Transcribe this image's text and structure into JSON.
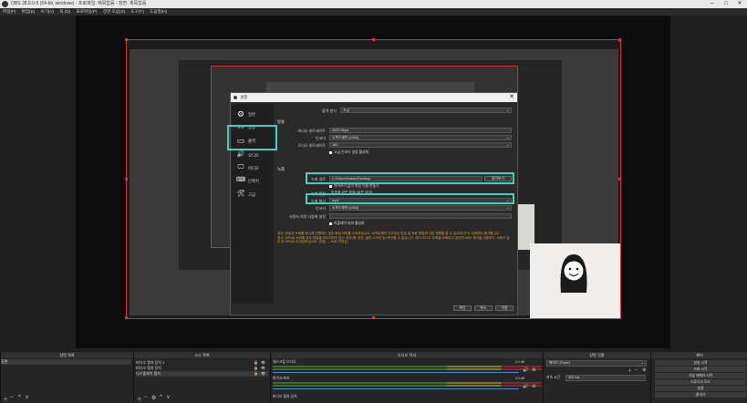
{
  "window": {
    "title": "OBS 28.0.0-5 (64-bit, windows) - 프로파일: 제목없음 - 장면: 제목없음",
    "minimize": "─",
    "maximize": "□",
    "close": "✕"
  },
  "menu": [
    "파일(F)",
    "편집(E)",
    "보기(V)",
    "독 (D)",
    "프로파일(P)",
    "장면 모음(S)",
    "도구(T)",
    "도움말(H)"
  ],
  "dialog": {
    "title": "설정",
    "close": "✕",
    "sidebar": [
      {
        "label": "일반",
        "icon": "gear-icon",
        "glyph": "⚙"
      },
      {
        "label": "방송",
        "icon": "stream-icon",
        "glyph": "((•))"
      },
      {
        "label": "출력",
        "icon": "output-icon",
        "glyph": "▭"
      },
      {
        "label": "오디오",
        "icon": "audio-icon",
        "glyph": "🔊"
      },
      {
        "label": "비디오",
        "icon": "video-icon",
        "glyph": "🖵"
      },
      {
        "label": "단축키",
        "icon": "hotkey-icon",
        "glyph": "⌨"
      },
      {
        "label": "고급",
        "icon": "advanced-icon",
        "glyph": "🛠"
      }
    ],
    "output_mode": {
      "label": "출력 방식",
      "value": "고급"
    },
    "streaming": {
      "section": "방송",
      "video_bitrate": {
        "label": "비디오 비트레이트",
        "value": "2500 Kbps"
      },
      "encoder": {
        "label": "인코더",
        "value": "소프트웨어 (x264)"
      },
      "audio_bitrate": {
        "label": "오디오 비트레이트",
        "value": "160"
      },
      "advanced_check": "고급 인코더 설정 활성화"
    },
    "recording": {
      "section": "녹화",
      "path": {
        "label": "녹화 경로",
        "value": "C:/Users/hndani/Desktop",
        "browse": "찾아보기"
      },
      "no_space_check": "띄어쓰기 없이 파일 이름 만들기",
      "quality": {
        "label": "녹화 품질",
        "value": "방송과 같은 품질 (낮은 크기)"
      },
      "format": {
        "label": "녹화 형식",
        "value": "mp4"
      },
      "encoder": {
        "label": "인코더",
        "value": "소프트웨어 (x264)"
      },
      "custom_mux": {
        "label": "사용자 지정 다중화 설정",
        "value": ""
      },
      "replay_check": "리플레이 버퍼 활성화"
    },
    "warning_1": "경고: 방송과 녹화를 동시에 진행하는 경우 화질 저하를 주의하십시오. 소프트웨어 인코딩이 방송 및 녹화 품질에 다른 영향을 줄 수 있으며 CPU 사용량이 증가합니다.",
    "warning_2": "경고: MP4로 녹화할 경우 파일을 마무리하지 않는 경우(예: 정전, 블루 스크린 등) 복구할 수 없습니다. 여러 오디오 트랙을 녹화하고 싶다면 MKV 형식을 사용하고, 녹화가 끝난 후 MP4로 리먹싱하십시오. (파일 → 녹화 리먹싱)",
    "buttons": {
      "ok": "확인",
      "cancel": "취소",
      "apply": "적용"
    }
  },
  "docks": {
    "scenes": {
      "title": "장면 목록",
      "items": [
        "장면"
      ]
    },
    "sources": {
      "title": "소스 목록",
      "items": [
        "비디오 캡처 장치 2",
        "비디오 캡처 장치",
        "디스플레이 캡처"
      ]
    },
    "mixer": {
      "title": "오디오 믹서",
      "channels": [
        {
          "name": "데스크탑 오디오",
          "db": "0.0 dB"
        },
        {
          "name": "마이크/보조",
          "db": "0.0 dB"
        },
        {
          "name": "비디오 캡처 장치",
          "db": ""
        }
      ]
    },
    "transitions": {
      "title": "장면 전환",
      "type": "페이드 (Fade)",
      "duration_label": "지속 시간",
      "duration": "300 ms"
    },
    "controls": {
      "title": "제어",
      "buttons": [
        "방송 시작",
        "녹화 시작",
        "가상 카메라 시작",
        "스튜디오 모드",
        "설정",
        "끝내기"
      ]
    }
  }
}
